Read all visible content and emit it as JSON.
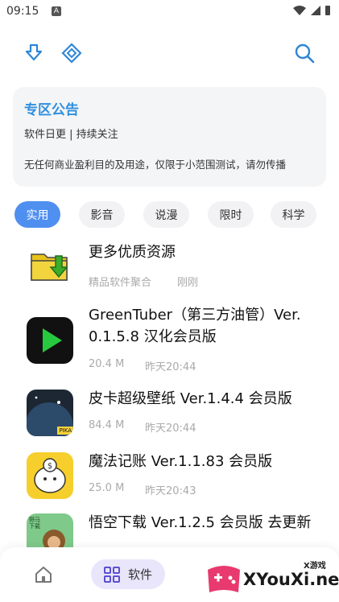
{
  "status_bar": {
    "time": "09:15",
    "notification_app": "A"
  },
  "toolbar": {
    "icons": [
      "download-icon",
      "diamond-grid-icon",
      "search-icon"
    ]
  },
  "notice": {
    "title": "专区公告",
    "line1": "软件日更 | 持续关注",
    "line2": "无任何商业盈利目的及用途，仅限于小范围测试，请勿传播"
  },
  "tabs": [
    "实用",
    "影音",
    "说漫",
    "限时",
    "科学"
  ],
  "active_tab": "实用",
  "items": [
    {
      "name": "更多优质资源",
      "meta": "精品软件聚合",
      "time": "刚刚"
    },
    {
      "name": "GreenTuber（第三方油管）Ver. 0.1.5.8 汉化会员版",
      "meta": "20.4 M",
      "time": "昨天20:44"
    },
    {
      "name": "皮卡超级壁纸 Ver.1.4.4 会员版",
      "meta": "84.4 M",
      "time": "昨天20:44"
    },
    {
      "name": "魔法记账 Ver.1.1.83 会员版",
      "meta": "25.0 M",
      "time": "昨天20:43"
    },
    {
      "name": "悟空下载 Ver.1.2.5 会员版 去更新",
      "meta": "",
      "time": ""
    }
  ],
  "icon_labels": {
    "pika": "PIKA",
    "wukong": "野马下载"
  },
  "bottom_nav": {
    "software_label": "软件"
  },
  "watermark": {
    "brand": "XYouXi.net",
    "small": "X游戏"
  },
  "colors": {
    "accent": "#4f8ff0",
    "notice_title": "#2f8fde",
    "nav_active_bg": "#e9e6fb"
  }
}
